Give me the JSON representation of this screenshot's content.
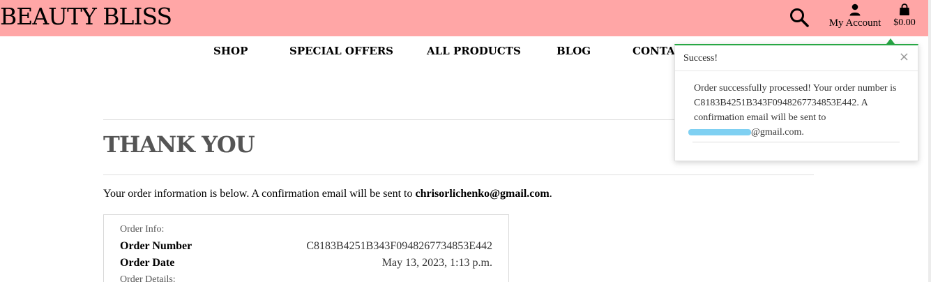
{
  "header": {
    "brand": "BEAUTY BLISS",
    "account_label": "My Account",
    "cart_total": "$0.00"
  },
  "nav": {
    "items": [
      "SHOP",
      "SPECIAL OFFERS",
      "ALL PRODUCTS",
      "BLOG",
      "CONTACT"
    ]
  },
  "main": {
    "title": "THANK YOU",
    "intro_prefix": "Your order information is below. A confirmation email will be sent to ",
    "intro_email": "chrisorlichenko@gmail.com",
    "intro_suffix": ".",
    "order_info_label": "Order Info:",
    "order_number_label": "Order Number",
    "order_number_value": "C8183B4251B343F0948267734853E442",
    "order_date_label": "Order Date",
    "order_date_value": "May 13, 2023, 1:13 p.m.",
    "order_details_label": "Order Details:"
  },
  "toast": {
    "title": "Success!",
    "close": "×",
    "message_line": "Order successfully processed! Your order number is C8183B4251B343F0948267734853E442. A confirmation email will be sent to",
    "email_suffix": "@gmail.com."
  },
  "colors": {
    "header_bg": "#ffa6a6",
    "toast_accent": "#28a745",
    "redaction": "#7fd0f2"
  },
  "icons": [
    "search-icon",
    "user-icon",
    "shopping-bag-icon",
    "close-icon"
  ]
}
